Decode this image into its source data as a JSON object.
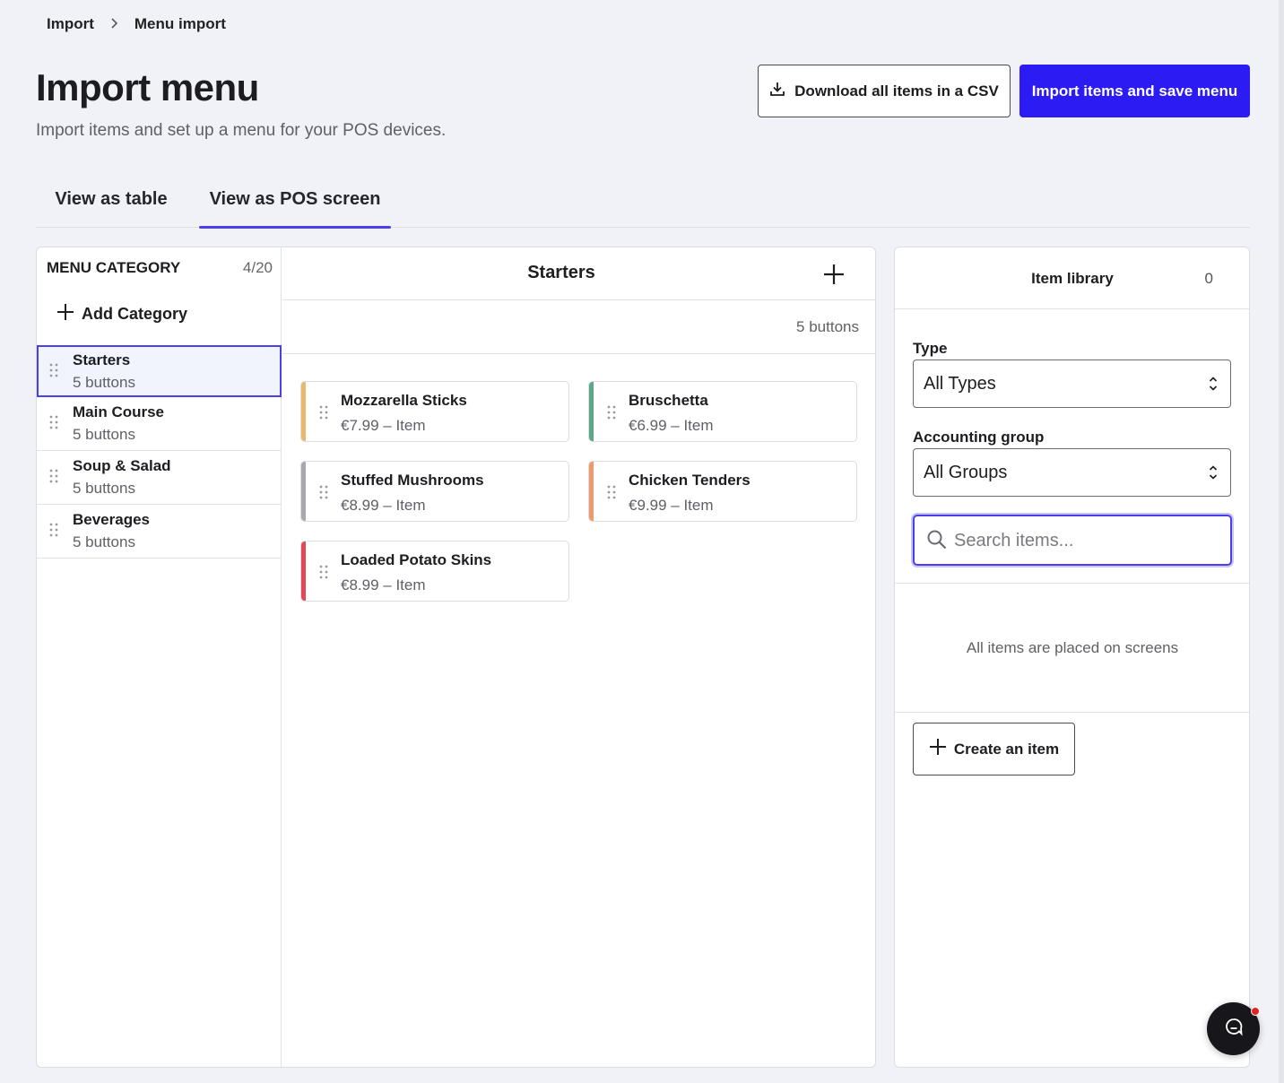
{
  "breadcrumb": {
    "root": "Import",
    "current": "Menu import"
  },
  "header": {
    "title": "Import menu",
    "subtitle": "Import items and set up a menu for your POS devices.",
    "download_label": "Download all items in a CSV",
    "primary_label": "Import items and save menu"
  },
  "tabs": [
    {
      "label": "View as table",
      "active": false
    },
    {
      "label": "View as POS screen",
      "active": true
    }
  ],
  "categories": {
    "header": "MENU CATEGORY",
    "count": "4/20",
    "add_label": "Add Category",
    "items": [
      {
        "name": "Starters",
        "sub": "5 buttons",
        "selected": true
      },
      {
        "name": "Main Course",
        "sub": "5 buttons",
        "selected": false
      },
      {
        "name": "Soup & Salad",
        "sub": "5 buttons",
        "selected": false
      },
      {
        "name": "Beverages",
        "sub": "5 buttons",
        "selected": false
      }
    ]
  },
  "screen": {
    "title": "Starters",
    "count": "5 buttons",
    "buttons": [
      {
        "name": "Mozzarella Sticks",
        "meta": "€7.99 – Item",
        "color": "#e9b86a"
      },
      {
        "name": "Bruschetta",
        "meta": "€6.99 – Item",
        "color": "#5aa886"
      },
      {
        "name": "Stuffed Mushrooms",
        "meta": "€8.99 – Item",
        "color": "#a8a8ad"
      },
      {
        "name": "Chicken Tenders",
        "meta": "€9.99 – Item",
        "color": "#ee9a6c"
      },
      {
        "name": "Loaded Potato Skins",
        "meta": "€8.99 – Item",
        "color": "#e2495b"
      }
    ]
  },
  "library": {
    "title": "Item library",
    "count": "0",
    "type_label": "Type",
    "type_value": "All Types",
    "group_label": "Accounting group",
    "group_value": "All Groups",
    "search_placeholder": "Search items...",
    "empty_text": "All items are placed on screens",
    "create_label": "Create an item"
  },
  "colors": {
    "accent": "#2c1bf2",
    "focus": "#4b40e8"
  }
}
